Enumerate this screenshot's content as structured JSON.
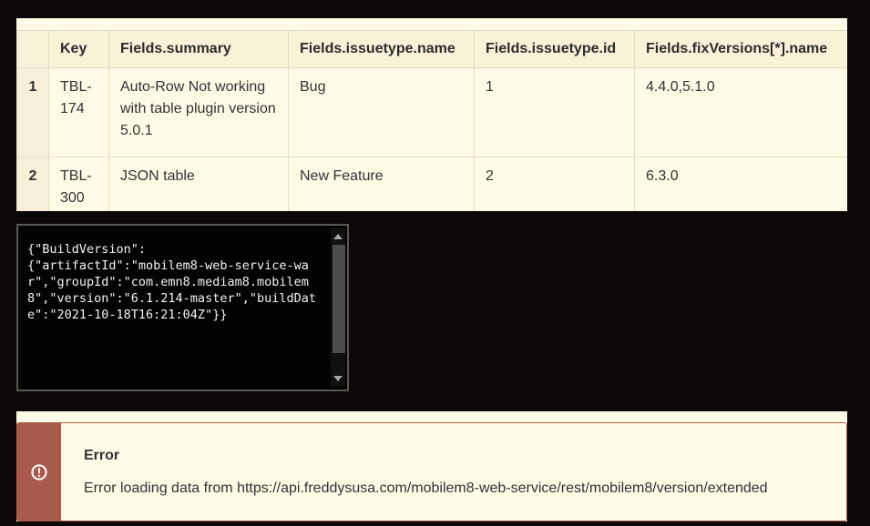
{
  "table": {
    "columns": [
      "",
      "Key",
      "Fields.summary",
      "Fields.issuetype.name",
      "Fields.issuetype.id",
      "Fields.fixVersions[*].name"
    ],
    "rows": [
      {
        "num": "1",
        "key": "TBL-174",
        "summary": "Auto-Row Not working with table plugin version 5.0.1",
        "issuetype_name": "Bug",
        "issuetype_id": "1",
        "fix_versions": "4.4.0,5.1.0"
      },
      {
        "num": "2",
        "key": "TBL-300",
        "summary": "JSON table",
        "issuetype_name": "New Feature",
        "issuetype_id": "2",
        "fix_versions": "6.3.0"
      }
    ]
  },
  "json_box": {
    "text": "{\"BuildVersion\":\n{\"artifactId\":\"mobilem8-web-service-war\",\"groupId\":\"com.emn8.mediam8.mobilem8\",\"version\":\"6.1.214-master\",\"buildDate\":\"2021-10-18T16:21:04Z\"}}"
  },
  "error": {
    "title": "Error",
    "message": "Error loading data from https://api.freddysusa.com/mobilem8-web-service/rest/mobilem8/version/extended",
    "icon": "exclamation-circle-icon",
    "accent_color": "#a95a4b"
  },
  "colors": {
    "background": "#0b0807",
    "panel": "#fefae6",
    "header": "#faf1d9"
  }
}
